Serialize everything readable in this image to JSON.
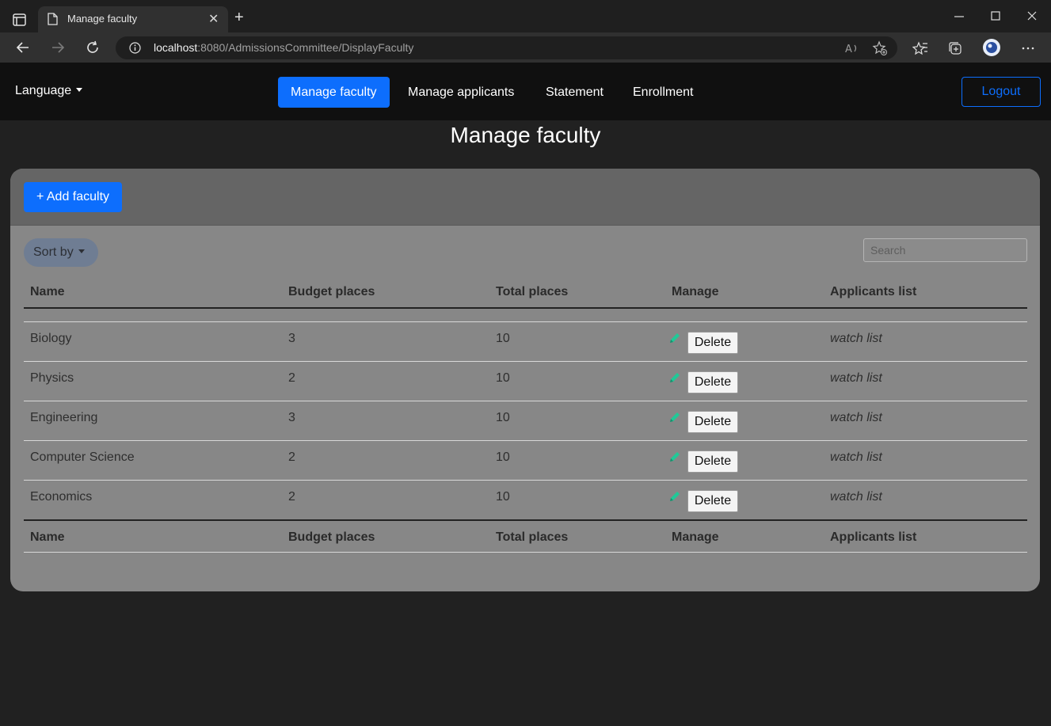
{
  "browser": {
    "tab_title": "Manage faculty",
    "tab_close": "✕",
    "new_tab": "+",
    "url_host": "localhost",
    "url_rest": ":8080/AdmissionsCommittee/DisplayFaculty"
  },
  "nav": {
    "language": "Language",
    "links": [
      "Manage faculty",
      "Manage applicants",
      "Statement",
      "Enrollment"
    ],
    "logout": "Logout"
  },
  "page": {
    "title": "Manage faculty",
    "add_button": "+ Add faculty",
    "sort_button": "Sort by",
    "search_placeholder": "Search"
  },
  "table": {
    "headers": [
      "Name",
      "Budget places",
      "Total places",
      "Manage",
      "Applicants list"
    ],
    "rows": [
      {
        "name": "Biology",
        "budget": "3",
        "total": "10",
        "delete": "Delete",
        "link": "watch list"
      },
      {
        "name": "Physics",
        "budget": "2",
        "total": "10",
        "delete": "Delete",
        "link": "watch list"
      },
      {
        "name": "Engineering",
        "budget": "3",
        "total": "10",
        "delete": "Delete",
        "link": "watch list"
      },
      {
        "name": "Computer Science",
        "budget": "2",
        "total": "10",
        "delete": "Delete",
        "link": "watch list"
      },
      {
        "name": "Economics",
        "budget": "2",
        "total": "10",
        "delete": "Delete",
        "link": "watch list"
      }
    ]
  },
  "colors": {
    "primary": "#0d6efd",
    "pencil": "#20c997"
  }
}
